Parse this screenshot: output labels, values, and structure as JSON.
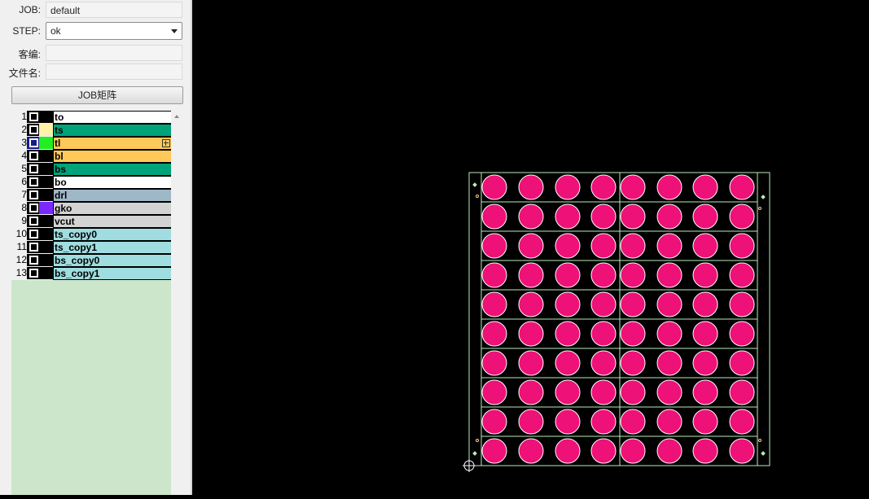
{
  "job": {
    "label": "JOB:",
    "value": "default"
  },
  "step": {
    "label": "STEP:",
    "value": "ok"
  },
  "customer": {
    "label": "客编:",
    "value": ""
  },
  "filename": {
    "label": "文件名:",
    "value": ""
  },
  "matrix_button": "JOB矩阵",
  "layers": [
    {
      "num": "1",
      "name": "to",
      "color": "#ffffff",
      "swatch": "#000000",
      "selected": false
    },
    {
      "num": "2",
      "name": "ts",
      "color": "#00a37a",
      "swatch": "#fff1a8",
      "selected": false
    },
    {
      "num": "3",
      "name": "tl",
      "color": "#ffc95a",
      "swatch": "#22ee22",
      "selected": true,
      "expandable": true
    },
    {
      "num": "4",
      "name": "bl",
      "color": "#ffc95a",
      "swatch": "#000000",
      "selected": false
    },
    {
      "num": "5",
      "name": "bs",
      "color": "#00a37a",
      "swatch": "#000000",
      "selected": false
    },
    {
      "num": "6",
      "name": "bo",
      "color": "#ffffff",
      "swatch": "#000000",
      "selected": false
    },
    {
      "num": "7",
      "name": "drl",
      "color": "#9fb8c8",
      "swatch": "#000000",
      "selected": false
    },
    {
      "num": "8",
      "name": "gko",
      "color": "#d3d3d3",
      "swatch": "#7a2aff",
      "selected": false
    },
    {
      "num": "9",
      "name": "vcut",
      "color": "#d3d3d3",
      "swatch": "#000000",
      "selected": false
    },
    {
      "num": "10",
      "name": "ts_copy0",
      "color": "#9fdde0",
      "swatch": "#000000",
      "selected": false
    },
    {
      "num": "11",
      "name": "ts_copy1",
      "color": "#9fdde0",
      "swatch": "#000000",
      "selected": false
    },
    {
      "num": "12",
      "name": "bs_copy0",
      "color": "#9fdde0",
      "swatch": "#000000",
      "selected": false
    },
    {
      "num": "13",
      "name": "bs_copy1",
      "color": "#9fdde0",
      "swatch": "#000000",
      "selected": false
    }
  ],
  "board": {
    "rows": 10,
    "cols": 8,
    "pad_color": "#ee1177",
    "outline_color": "#b8ecb8"
  }
}
